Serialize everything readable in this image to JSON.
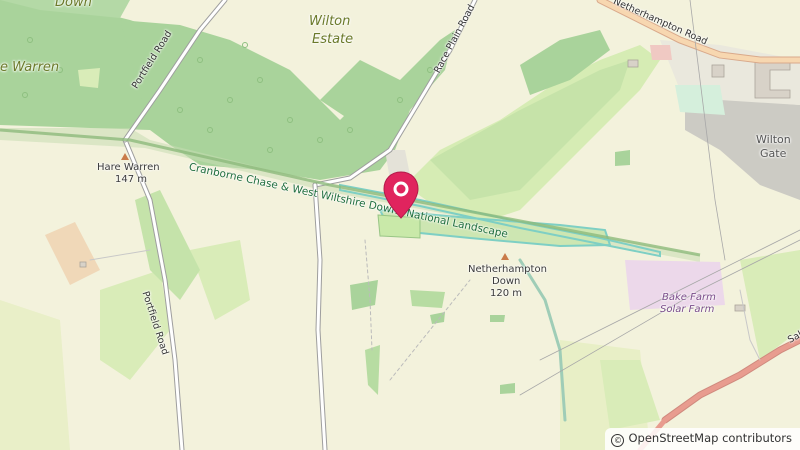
{
  "map": {
    "labels": {
      "wilton_estate_1": "Wilton",
      "wilton_estate_2": "Estate",
      "down_top": "Down",
      "hare_warren_left": "e Warren",
      "hare_warren": "Hare Warren",
      "hare_warren_elev": "147 m",
      "portfield_road_top": "Portfield Road",
      "portfield_road_bottom": "Portfield Road",
      "race_plain_road": "Race Plain Road",
      "netherhampton_road": "Netherhampton Road",
      "national_landscape": "Cranborne Chase & West Wiltshire Downs National Landscape",
      "netherhampton_down_1": "Netherhampton",
      "netherhampton_down_2": "Down",
      "netherhampton_down_elev": "120 m",
      "wilton_gate_1": "Wilton",
      "wilton_gate_2": "Gate",
      "bake_farm_1": "Bake Farm",
      "bake_farm_2": "Solar Farm",
      "road_edge": "Sali"
    },
    "marker": {
      "icon": "location-pin-icon",
      "color": "#e0245e"
    },
    "colors": {
      "background": "#f3f2dc",
      "forest": "#a9d39b",
      "forest_dark": "#9ccb8e",
      "grass": "#d6ecb4",
      "park_boundary": "#8dba7c",
      "track": "#c6ddb2",
      "solar_farm": "#ecd8ea",
      "industrial": "#cccbc4",
      "main_road": "#e89c8f"
    }
  },
  "attribution": {
    "symbol": "©",
    "text": "OpenStreetMap contributors"
  }
}
